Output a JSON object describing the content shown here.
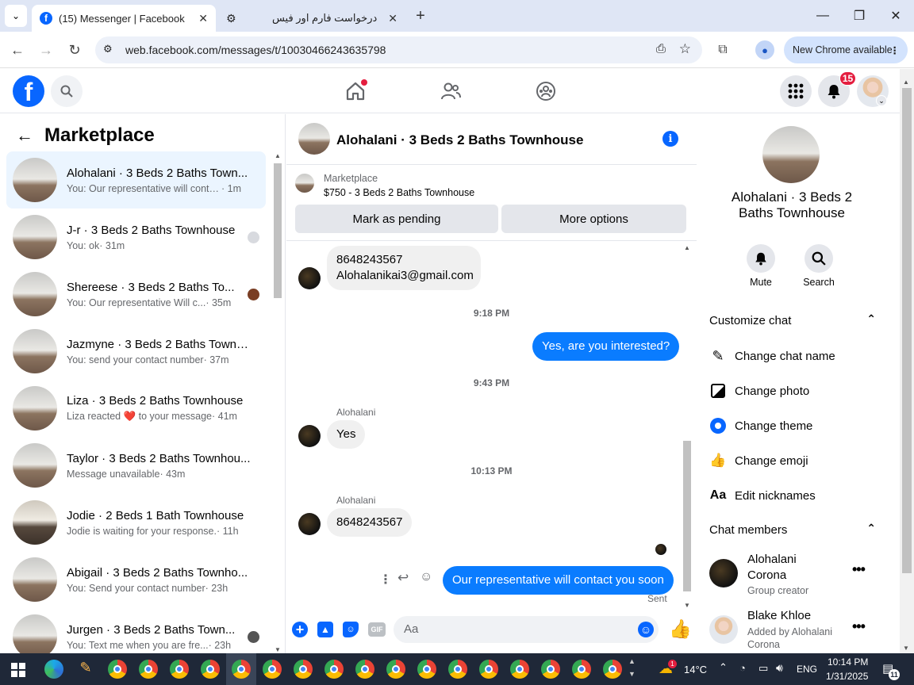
{
  "browser": {
    "tabs": [
      {
        "title": "(15) Messenger | Facebook"
      },
      {
        "title": "درخواست فارم اور فیس"
      }
    ],
    "url": "web.facebook.com/messages/t/10030466243635798",
    "new_chrome": "New Chrome available"
  },
  "fb": {
    "notifications_count": "15",
    "brand_color": "#0866ff"
  },
  "left": {
    "title": "Marketplace",
    "conversations": [
      {
        "name": "Alohalani · 3 Beds 2 Baths Town...",
        "preview": "You: Our representative will conta...",
        "time": " · 1m"
      },
      {
        "name": "J-r · 3 Beds 2 Baths Townhouse",
        "preview": "You: ok",
        "time": " · 31m"
      },
      {
        "name": "Shereese · 3 Beds 2 Baths To...",
        "preview": "You: Our representative Will c...",
        "time": " · 35m"
      },
      {
        "name": "Jazmyne · 3 Beds 2 Baths Townh...",
        "preview": "You: send your contact number",
        "time": " · 37m"
      },
      {
        "name": "Liza · 3 Beds 2 Baths Townhouse",
        "preview": "Liza reacted ❤️ to your message",
        "time": " · 41m"
      },
      {
        "name": "Taylor · 3 Beds 2 Baths Townhou...",
        "preview": "Message unavailable",
        "time": " · 43m"
      },
      {
        "name": "Jodie · 2 Beds 1 Bath Townhouse",
        "preview": "Jodie is waiting for your response.",
        "time": " · 11h"
      },
      {
        "name": "Abigail · 3 Beds 2 Baths Townho...",
        "preview": "You: Send your contact number",
        "time": " · 23h"
      },
      {
        "name": "Jurgen · 3 Beds 2 Baths Town...",
        "preview": "You: Text me when you are fre...",
        "time": " · 23h"
      }
    ]
  },
  "chat": {
    "title": "Alohalani · 3 Beds 2 Baths Townhouse",
    "listing": {
      "label": "Marketplace",
      "price_title": "$750 - 3 Beds 2 Baths Townhouse"
    },
    "mark_pending": "Mark as pending",
    "more_options": "More options",
    "messages": {
      "msg1_line1": "8648243567",
      "msg1_line2": "Alohalanikai3@gmail.com",
      "time1": "9:18 PM",
      "out1": "Yes, are you interested?",
      "time2": "9:43 PM",
      "sender": "Alohalani",
      "msg2": "Yes",
      "time3": "10:13 PM",
      "msg3": "8648243567",
      "out2": "Our representative will contact you soon",
      "status": "Sent"
    },
    "composer_placeholder": "Aa"
  },
  "right": {
    "name": "Alohalani · 3 Beds 2 Baths Townhouse",
    "mute": "Mute",
    "search": "Search",
    "customize": "Customize chat",
    "options": [
      "Change chat name",
      "Change photo",
      "Change theme",
      "Change emoji",
      "Edit nicknames"
    ],
    "members_title": "Chat members",
    "members": [
      {
        "name": "Alohalani Corona",
        "role": "Group creator"
      },
      {
        "name": "Blake Khloe",
        "role": "Added by Alohalani Corona"
      }
    ]
  },
  "taskbar": {
    "temperature": "14°C",
    "lang": "ENG",
    "time": "10:14 PM",
    "date": "1/31/2025",
    "notif": "11"
  }
}
